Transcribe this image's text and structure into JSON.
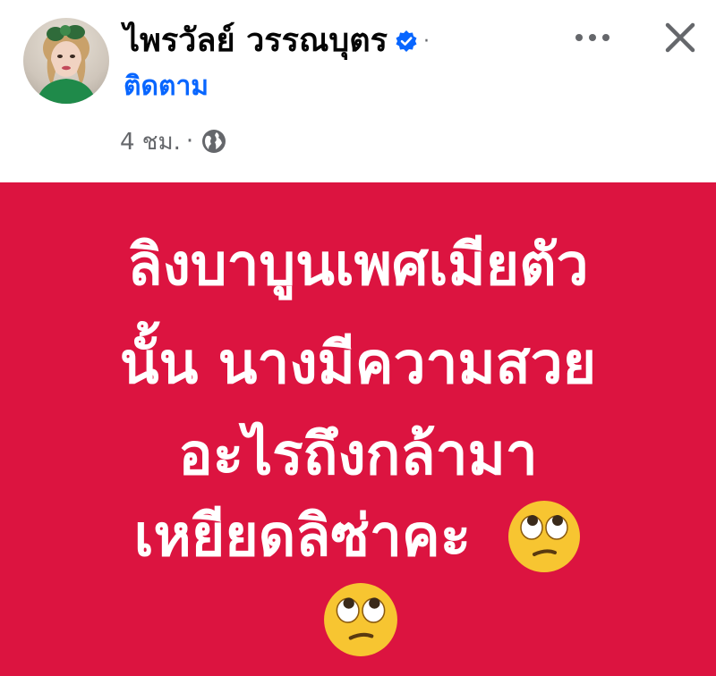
{
  "post": {
    "author_name": "ไพรวัลย์ วรรณบุตร",
    "follow_label": "ติดตาม",
    "timestamp": "4 ชม.",
    "separator": "·",
    "audience_icon": "globe-icon",
    "verified_icon": "verified-badge-icon",
    "more_icon": "more-horizontal-icon",
    "close_icon": "close-icon"
  },
  "card": {
    "background_color": "#dc1440",
    "text_color": "#ffffff",
    "lines": [
      "ลิงบาบูนเพศเมียตัว",
      "นั้น นางมีความสวย",
      "อะไรถึงกล้ามา",
      "เหยียดลิซ่าคะ"
    ],
    "emoji": "face-with-rolling-eyes-icon"
  },
  "colors": {
    "link_blue": "#0866ff",
    "meta_gray": "#65676b",
    "name_black": "#050505"
  }
}
